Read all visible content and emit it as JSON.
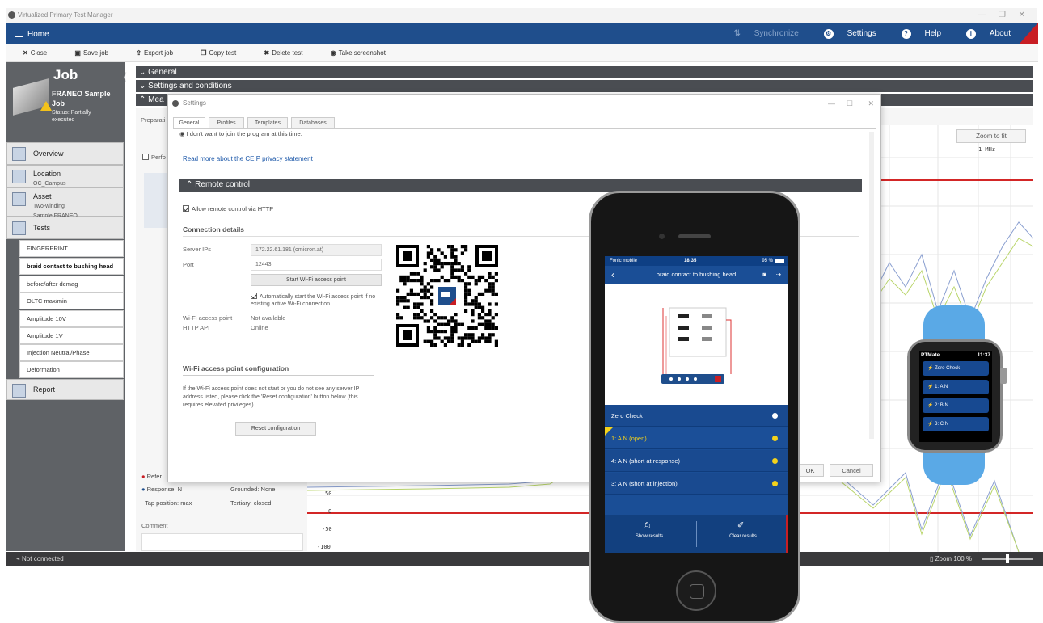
{
  "window": {
    "title": "Virtualized Primary Test Manager"
  },
  "home": {
    "label": "Home",
    "synchronize": "Synchronize",
    "settings": "Settings",
    "help": "Help",
    "about": "About"
  },
  "toolbar": {
    "close": "Close",
    "save_job": "Save job",
    "export_job": "Export job",
    "copy_test": "Copy test",
    "delete_test": "Delete test",
    "take_screenshot": "Take screenshot"
  },
  "job": {
    "title": "Job",
    "name": "FRANEO Sample Job",
    "status": "Status: Partially executed"
  },
  "nav": {
    "overview": "Overview",
    "location": "Location",
    "location_sub": "OC_Campus",
    "asset": "Asset",
    "asset_sub1": "Two-winding",
    "asset_sub2": "Sample FRANEO",
    "tests": "Tests",
    "report": "Report"
  },
  "tests": [
    "FINGERPRINT",
    "braid contact to bushing head",
    "before/after demag",
    "OLTC max/min",
    "Amplitude 10V",
    "Amplitude 1V",
    "Injection Neutral/Phase",
    "Deformation"
  ],
  "sections": {
    "general": "General",
    "settings_conditions": "Settings and conditions",
    "measurement": "Mea"
  },
  "main": {
    "preparation": "Preparati",
    "perform": "Perfo",
    "zoom_to_fit": "Zoom to fit",
    "freq_label": "1 MHz"
  },
  "reference": {
    "ref": "Refer",
    "response": "Response:",
    "response_val": "N",
    "grounded": "Grounded:",
    "grounded_val": "None",
    "tap": "Tap position:",
    "tap_val": "max",
    "tertiary": "Tertiary:",
    "tertiary_val": "closed",
    "comment": "Comment"
  },
  "y_ticks": [
    "50",
    "0",
    "-50",
    "-100"
  ],
  "statusbar": {
    "connection": "Not connected",
    "zoom": "Zoom  100 %"
  },
  "dialog": {
    "title": "Settings",
    "tabs": [
      "General",
      "Profiles",
      "Templates",
      "Databases"
    ],
    "radio_text": "I don't want to join the program at this time.",
    "ceip_link": "Read more about the CEIP privacy statement",
    "remote_control": "Remote control",
    "allow_http": "Allow remote control via HTTP",
    "connection_details": "Connection details",
    "server_ips_label": "Server IPs",
    "server_ips_value": "172.22.61.181 (omicron.at)",
    "port_label": "Port",
    "port_value": "12443",
    "start_wifi": "Start Wi-Fi access point",
    "auto_start": "Automatically start the Wi-Fi access point if no existing active Wi-Fi connection",
    "wifi_ap_label": "Wi-Fi access point",
    "wifi_ap_value": "Not available",
    "http_api_label": "HTTP API",
    "http_api_value": "Online",
    "wifi_config_title": "Wi-Fi access point configuration",
    "wifi_config_text": "If the Wi-Fi access point does not start or you do not see any server IP address listed, please click the 'Reset configuration' button below (this requires elevated privileges).",
    "reset_button": "Reset configuration",
    "ok": "OK",
    "cancel": "Cancel"
  },
  "phone": {
    "carrier": "Fonic mobile",
    "time": "18:35",
    "battery": "95 %",
    "screen_title": "braid contact to bushing head",
    "rows": [
      {
        "label": "Zero Check",
        "dot": "#ffffff"
      },
      {
        "label": "1: A N (open)",
        "dot": "#f3d21b"
      },
      {
        "label": "4: A N (short at response)",
        "dot": "#f3d21b"
      },
      {
        "label": "3: A N (short at injection)",
        "dot": "#f3d21b"
      }
    ],
    "show_results": "Show results",
    "clear_results": "Clear results"
  },
  "watch": {
    "app": "PTMate",
    "time": "11:37",
    "items": [
      "Zero Check",
      "1: A N",
      "2: B N",
      "3: C N"
    ]
  },
  "colors": {
    "accent": "#1f4e8c",
    "alert": "#c81e24",
    "section": "#4a4d52"
  }
}
